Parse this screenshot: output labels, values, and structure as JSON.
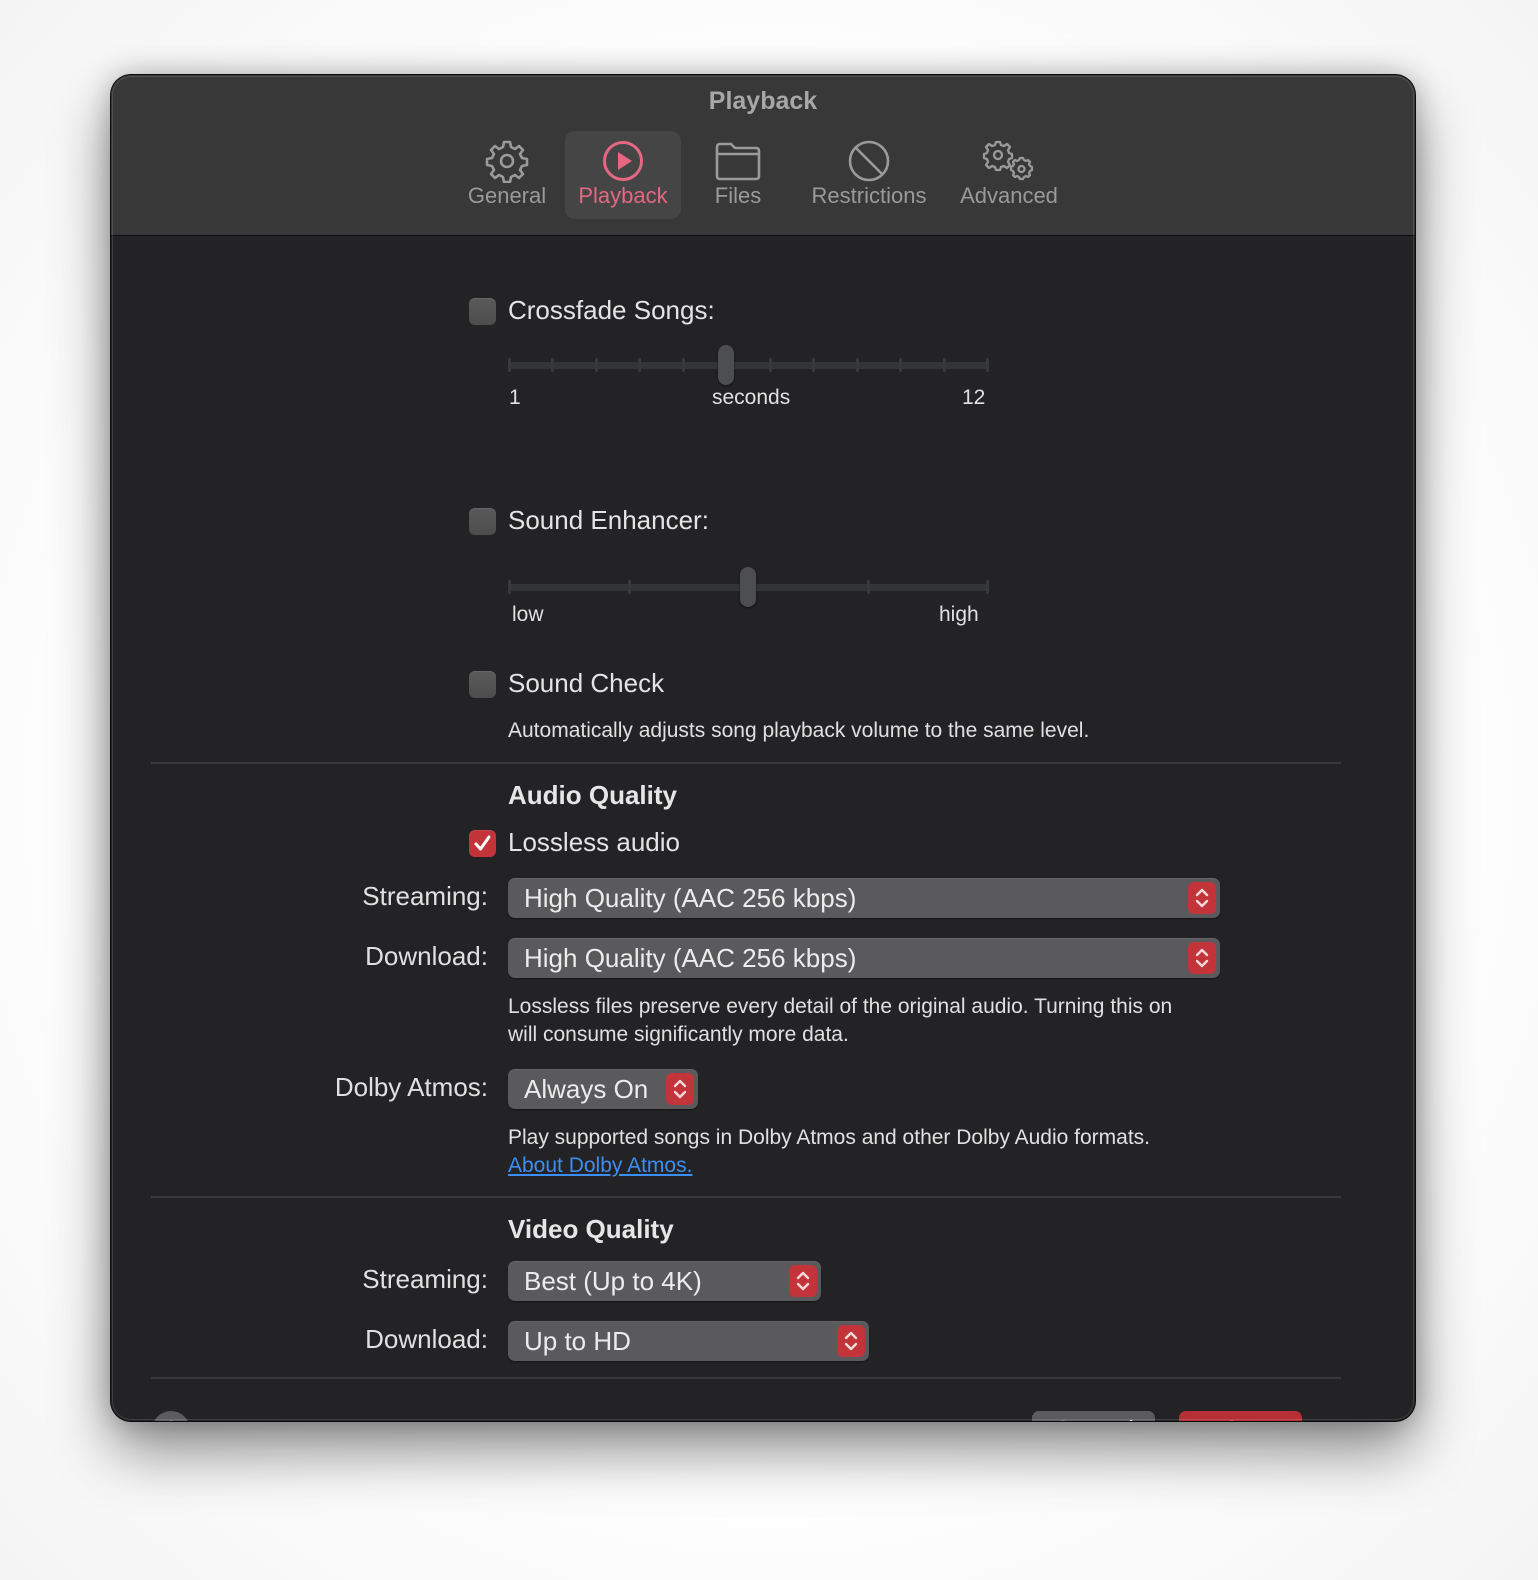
{
  "window": {
    "title": "Playback"
  },
  "tabs": [
    {
      "id": "general",
      "label": "General",
      "icon": "gear-icon",
      "active": false
    },
    {
      "id": "playback",
      "label": "Playback",
      "icon": "play-circle-icon",
      "active": true
    },
    {
      "id": "files",
      "label": "Files",
      "icon": "folder-icon",
      "active": false
    },
    {
      "id": "restrictions",
      "label": "Restrictions",
      "icon": "prohibited-icon",
      "active": false
    },
    {
      "id": "advanced",
      "label": "Advanced",
      "icon": "gears-icon",
      "active": false
    }
  ],
  "colors": {
    "accent": "#c3343a",
    "active_tab": "#e56781",
    "link": "#3d8ef2"
  },
  "crossfade": {
    "label": "Crossfade Songs:",
    "checked": false,
    "slider": {
      "min": 1,
      "max": 12,
      "value": 6,
      "tick_count": 12
    },
    "min_label": "1",
    "unit_label": "seconds",
    "max_label": "12"
  },
  "sound_enhancer": {
    "label": "Sound Enhancer:",
    "checked": false,
    "slider": {
      "value_fraction": 0.5,
      "tick_count": 5
    },
    "min_label": "low",
    "max_label": "high"
  },
  "sound_check": {
    "label": "Sound Check",
    "checked": false,
    "description": "Automatically adjusts song playback volume to the same level."
  },
  "audio_quality": {
    "heading": "Audio Quality",
    "lossless": {
      "label": "Lossless audio",
      "checked": true
    },
    "streaming": {
      "label": "Streaming:",
      "value": "High Quality (AAC 256 kbps)"
    },
    "download": {
      "label": "Download:",
      "value": "High Quality (AAC 256 kbps)"
    },
    "lossless_description_1": "Lossless files preserve every detail of the original audio. Turning this on",
    "lossless_description_2": "will consume significantly more data.",
    "dolby": {
      "label": "Dolby Atmos:",
      "value": "Always On"
    },
    "dolby_description": "Play supported songs in Dolby Atmos and other Dolby Audio formats.",
    "dolby_link": "About Dolby Atmos."
  },
  "video_quality": {
    "heading": "Video Quality",
    "streaming": {
      "label": "Streaming:",
      "value": "Best (Up to 4K)"
    },
    "download": {
      "label": "Download:",
      "value": "Up to HD"
    }
  },
  "footer": {
    "help_label": "?",
    "cancel_label": "Cancel",
    "ok_label": "OK"
  }
}
